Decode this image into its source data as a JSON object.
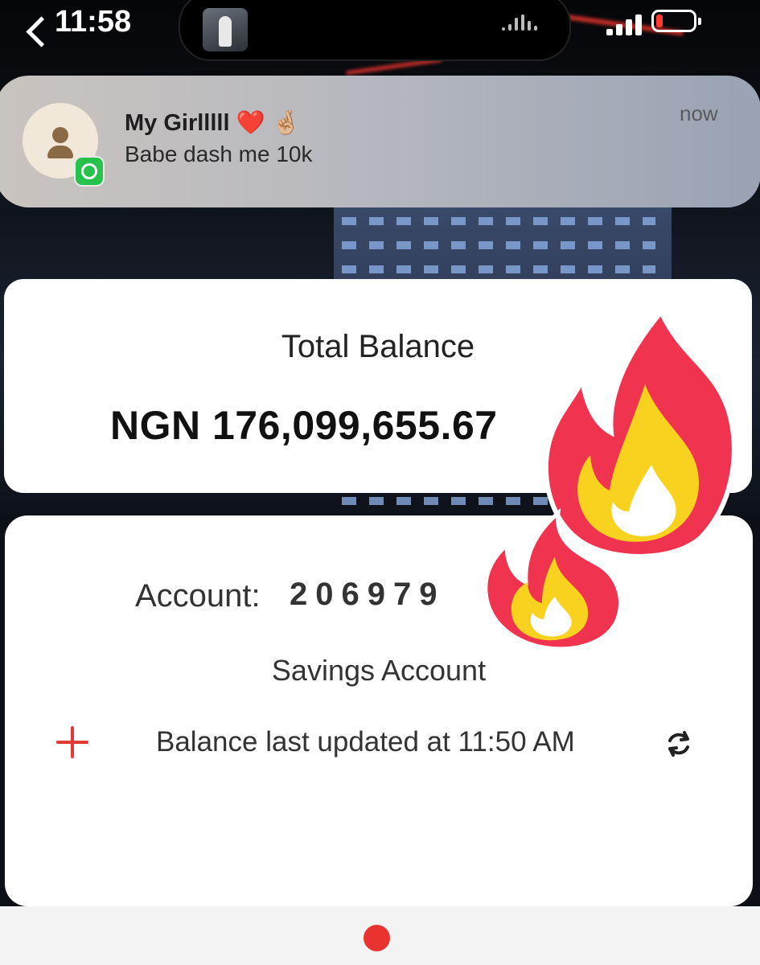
{
  "status_bar": {
    "time": "11:58"
  },
  "notification": {
    "app_icon": "whatsapp-icon",
    "sender": "My Girlllll ❤️ 🤞🏼",
    "message": "Babe dash me 10k",
    "time": "now"
  },
  "balance": {
    "label": "Total Balance",
    "value": "NGN 176,099,655.67"
  },
  "account": {
    "label": "Account:",
    "number": "206979",
    "type": "Savings Account",
    "updated_text": "Balance last updated at 11:50 AM",
    "add_icon": "plus-icon",
    "refresh_icon": "refresh-icon"
  },
  "colors": {
    "accent": "#e8332f",
    "whatsapp": "#27c24c",
    "fire_red": "#f0344f",
    "fire_yellow": "#f9d21f"
  },
  "stickers": [
    "fire-emoji",
    "fire-emoji"
  ]
}
